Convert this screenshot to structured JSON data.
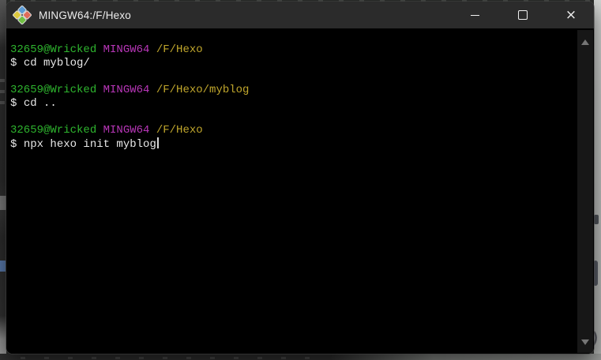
{
  "window": {
    "title": "MINGW64:/F/Hexo",
    "app_icon": "msys2-diamonds-icon",
    "controls": {
      "minimize": "minimize",
      "maximize": "maximize",
      "close": "close"
    }
  },
  "terminal": {
    "prompt_symbol": "$",
    "colors": {
      "background": "#000000",
      "titlebar": "#2b2b2b",
      "user_host": "#2eb52e",
      "env_name": "#b836b8",
      "path": "#c0a62c",
      "command_text": "#e8e8e8"
    },
    "blocks": [
      {
        "user": "32659@Wricked",
        "env": "MINGW64",
        "path": "/F/Hexo",
        "command": "cd myblog/"
      },
      {
        "user": "32659@Wricked",
        "env": "MINGW64",
        "path": "/F/Hexo/myblog",
        "command": "cd .."
      },
      {
        "user": "32659@Wricked",
        "env": "MINGW64",
        "path": "/F/Hexo",
        "command": "npx hexo init myblog"
      }
    ]
  }
}
